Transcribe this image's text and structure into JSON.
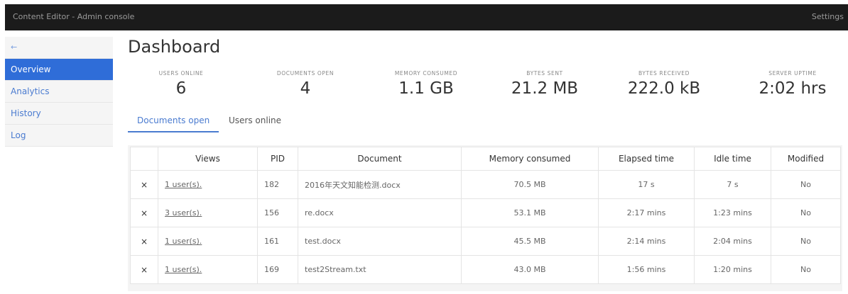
{
  "header": {
    "title": "Content Editor - Admin console",
    "settings_label": "Settings"
  },
  "sidebar": {
    "back_label": "←",
    "items": [
      {
        "label": "Overview",
        "active": true
      },
      {
        "label": "Analytics"
      },
      {
        "label": "History"
      },
      {
        "label": "Log"
      }
    ]
  },
  "main": {
    "title": "Dashboard",
    "stats": [
      {
        "label": "USERS ONLINE",
        "value": "6"
      },
      {
        "label": "DOCUMENTS OPEN",
        "value": "4"
      },
      {
        "label": "MEMORY CONSUMED",
        "value": "1.1 GB"
      },
      {
        "label": "BYTES SENT",
        "value": "21.2 MB"
      },
      {
        "label": "BYTES RECEIVED",
        "value": "222.0 kB"
      },
      {
        "label": "SERVER UPTIME",
        "value": "2:02 hrs"
      }
    ],
    "tabs": [
      {
        "label": "Documents open",
        "active": true
      },
      {
        "label": "Users online"
      }
    ],
    "table": {
      "headers": [
        "",
        "Views",
        "PID",
        "Document",
        "Memory consumed",
        "Elapsed time",
        "Idle time",
        "Modified"
      ],
      "rows": [
        {
          "close": "×",
          "views": "1 user(s).",
          "pid": "182",
          "document": "2016年天文知能检测.docx",
          "memory": "70.5 MB",
          "elapsed": "17 s",
          "idle": "7 s",
          "modified": "No"
        },
        {
          "close": "×",
          "views": "3 user(s).",
          "pid": "156",
          "document": "re.docx",
          "memory": "53.1 MB",
          "elapsed": "2:17 mins",
          "idle": "1:23 mins",
          "modified": "No"
        },
        {
          "close": "×",
          "views": "1 user(s).",
          "pid": "161",
          "document": "test.docx",
          "memory": "45.5 MB",
          "elapsed": "2:14 mins",
          "idle": "2:04 mins",
          "modified": "No"
        },
        {
          "close": "×",
          "views": "1 user(s).",
          "pid": "169",
          "document": "test2Stream.txt",
          "memory": "43.0 MB",
          "elapsed": "1:56 mins",
          "idle": "1:20 mins",
          "modified": "No"
        }
      ]
    }
  }
}
